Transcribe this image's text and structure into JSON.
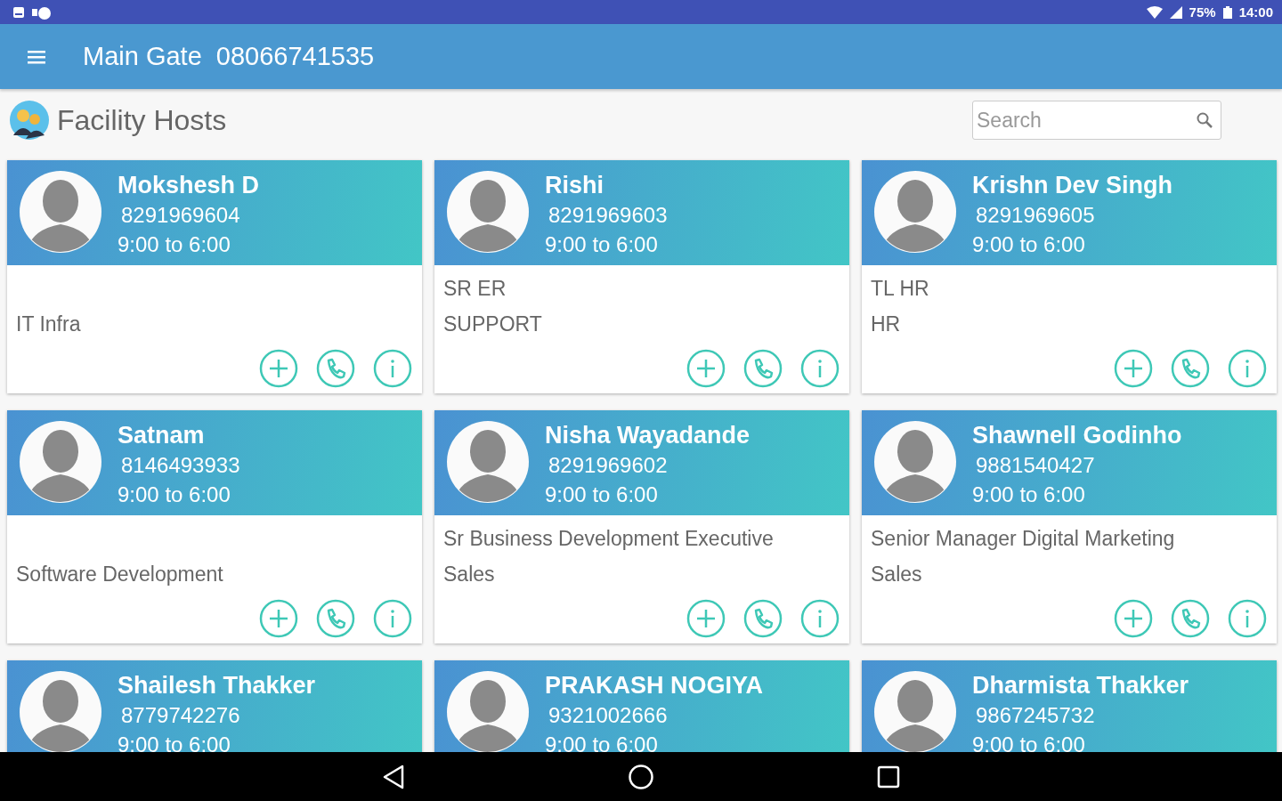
{
  "status_bar": {
    "battery": "75%",
    "time": "14:00"
  },
  "app_bar": {
    "title": "Main Gate",
    "phone": "08066741535"
  },
  "page": {
    "title": "Facility Hosts"
  },
  "search": {
    "placeholder": "Search"
  },
  "hosts": [
    {
      "name": "Mokshesh D",
      "phone": "8291969604",
      "hours": "9:00 to 6:00",
      "department": "IT Infra"
    },
    {
      "name": "Rishi",
      "phone": "8291969603",
      "hours": "9:00 to 6:00",
      "designation": "SR ER",
      "department": "SUPPORT"
    },
    {
      "name": "Krishn Dev Singh",
      "phone": "8291969605",
      "hours": "9:00 to 6:00",
      "designation": "TL HR",
      "department": "HR"
    },
    {
      "name": "Satnam",
      "phone": "8146493933",
      "hours": "9:00 to 6:00",
      "department": "Software Development"
    },
    {
      "name": "Nisha Wayadande",
      "phone": "8291969602",
      "hours": "9:00 to 6:00",
      "designation": "Sr Business Development Executive",
      "department": "Sales"
    },
    {
      "name": "Shawnell Godinho",
      "phone": "9881540427",
      "hours": "9:00 to 6:00",
      "designation": "Senior Manager Digital Marketing",
      "department": "Sales"
    },
    {
      "name": "Shailesh Thakker",
      "phone": "8779742276",
      "hours": "9:00 to 6:00"
    },
    {
      "name": "PRAKASH NOGIYA",
      "phone": "9321002666",
      "hours": "9:00 to 6:00"
    },
    {
      "name": "Dharmista Thakker",
      "phone": "9867245732",
      "hours": "9:00 to 6:00"
    }
  ]
}
